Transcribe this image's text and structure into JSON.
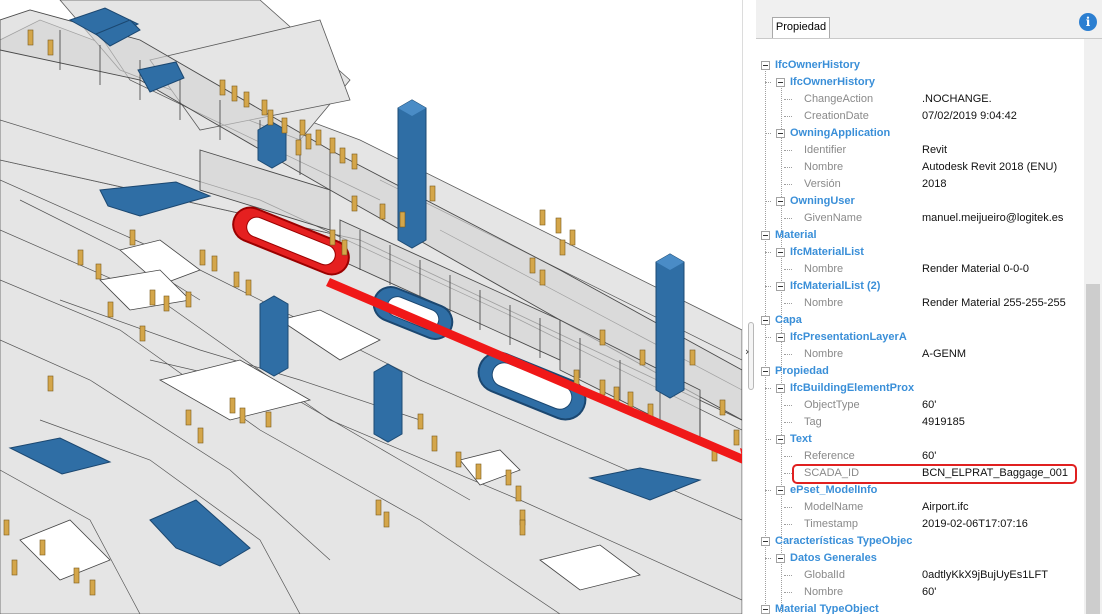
{
  "panel": {
    "tab_label": "Propiedad",
    "info_icon": "i",
    "rows": [
      {
        "level": 0,
        "label": "IfcOwnerHistory"
      },
      {
        "level": 1,
        "label": "IfcOwnerHistory"
      },
      {
        "level": 2,
        "label": "ChangeAction",
        "value": ".NOCHANGE."
      },
      {
        "level": 2,
        "label": "CreationDate",
        "value": "07/02/2019 9:04:42"
      },
      {
        "level": 1,
        "label": "OwningApplication"
      },
      {
        "level": 2,
        "label": "Identifier",
        "value": "Revit"
      },
      {
        "level": 2,
        "label": "Nombre",
        "value": "Autodesk Revit 2018 (ENU)"
      },
      {
        "level": 2,
        "label": "Versión",
        "value": "2018"
      },
      {
        "level": 1,
        "label": "OwningUser"
      },
      {
        "level": 2,
        "label": "GivenName",
        "value": "manuel.meijueiro@logitek.es"
      },
      {
        "level": 0,
        "label": "Material"
      },
      {
        "level": 1,
        "label": "IfcMaterialList"
      },
      {
        "level": 2,
        "label": "Nombre",
        "value": "Render Material 0-0-0"
      },
      {
        "level": 1,
        "label": "IfcMaterialList (2)"
      },
      {
        "level": 2,
        "label": "Nombre",
        "value": "Render Material 255-255-255"
      },
      {
        "level": 0,
        "label": "Capa"
      },
      {
        "level": 1,
        "label": "IfcPresentationLayerA"
      },
      {
        "level": 2,
        "label": "Nombre",
        "value": "A-GENM"
      },
      {
        "level": 0,
        "label": "Propiedad"
      },
      {
        "level": 1,
        "label": "IfcBuildingElementProx"
      },
      {
        "level": 2,
        "label": "ObjectType",
        "value": "60'"
      },
      {
        "level": 2,
        "label": "Tag",
        "value": "4919185"
      },
      {
        "level": 1,
        "label": "Text"
      },
      {
        "level": 2,
        "label": "Reference",
        "value": "60'"
      },
      {
        "level": 2,
        "label": "SCADA_ID",
        "value": "BCN_ELPRAT_Baggage_001"
      },
      {
        "level": 1,
        "label": "ePset_ModelInfo"
      },
      {
        "level": 2,
        "label": "ModelName",
        "value": "Airport.ifc"
      },
      {
        "level": 2,
        "label": "Timestamp",
        "value": "2019-02-06T17:07:16"
      },
      {
        "level": 0,
        "label": "Características TypeObjec"
      },
      {
        "level": 1,
        "label": "Datos Generales"
      },
      {
        "level": 2,
        "label": "GlobalId",
        "value": "0adtlyKkX9jBujUyEs1LFT"
      },
      {
        "level": 2,
        "label": "Nombre",
        "value": "60'"
      },
      {
        "level": 0,
        "label": "Material TypeObject"
      }
    ]
  },
  "splitter_icon": "›",
  "colors": {
    "tree_blue": "#3a8fd8",
    "highlight_red": "#e02020",
    "escalator_blue": "#2d6fa6",
    "floor_gray": "#e6e6e6",
    "gate_gold": "#d4a64a"
  },
  "viewport": {
    "icon": "3d-airport-model",
    "selected_item_icon": "baggage-carousel"
  }
}
